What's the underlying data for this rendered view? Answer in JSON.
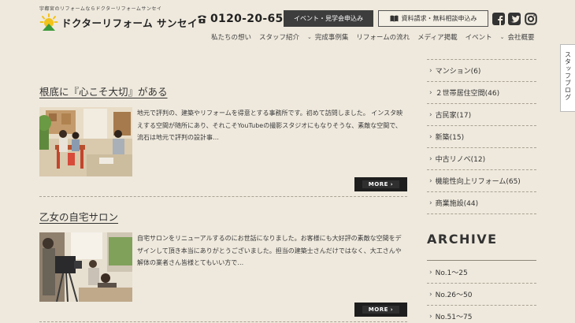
{
  "header": {
    "tagline": "宇都宮のリフォームならドクターリフォームサンセイ",
    "logo_text": "ドクターリフォーム サンセイ",
    "phone": "0120-20-6551",
    "event_button": "イベント・見学会申込み",
    "doc_button": "資料請求・無料相談申込み",
    "social_icons": [
      "facebook-icon",
      "twitter-icon",
      "instagram-icon"
    ]
  },
  "nav": {
    "items": [
      {
        "label": "私たちの想い",
        "chevron": false
      },
      {
        "label": "スタッフ紹介",
        "chevron": false
      },
      {
        "label": "完成事例集",
        "chevron": true
      },
      {
        "label": "リフォームの流れ",
        "chevron": false
      },
      {
        "label": "メディア掲載",
        "chevron": false
      },
      {
        "label": "イベント",
        "chevron": false
      },
      {
        "label": "会社概要",
        "chevron": true
      }
    ]
  },
  "side_tab": {
    "label": "スタッフブログ"
  },
  "articles": [
    {
      "title": "根底に『心こそ大切』がある",
      "excerpt": "地元で評判の、建築やリフォームを得意とする事務所です。初めて訪問しました。 インスタ映えする空間が随所にあり、それこそYouTubeの撮影スタジオにもなりそうな、素敵な空間で、流石は地元で評判の設計事…",
      "more": "MORE ›"
    },
    {
      "title": "乙女の自宅サロン",
      "excerpt": "自宅サロンをリニューアルするのにお世話になりました。お客様にも大好評の素敵な空間をデザインして頂き本当にありがとうございました。担当の建築士さんだけではなく、大工さんや解体の業者さん皆様とてもいい方で…",
      "more": "MORE ›"
    }
  ],
  "sidebar": {
    "categories": [
      "マンション(6)",
      "２世帯居住空間(46)",
      "古民家(17)",
      "新築(15)",
      "中古リノベ(12)",
      "機能性向上リフォーム(65)",
      "商業施設(44)"
    ],
    "archive_title": "ARCHIVE",
    "archive": [
      "No.1〜25",
      "No.26〜50",
      "No.51〜75"
    ]
  },
  "colors": {
    "background": "#efe9dd",
    "dark_button": "#3d3d3d",
    "logo_yellow": "#f2c21b",
    "logo_green": "#3b9a3b"
  }
}
